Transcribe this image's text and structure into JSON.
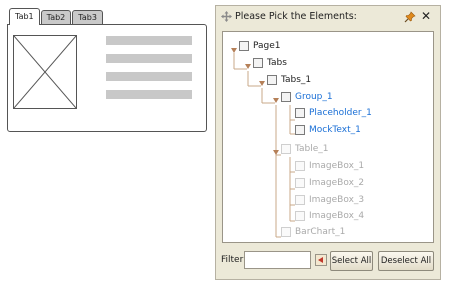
{
  "mockup": {
    "tabs": [
      "Tab1",
      "Tab2",
      "Tab3"
    ],
    "active_tab": "Tab1"
  },
  "dialog": {
    "title": "Please Pick the Elements:",
    "icons": {
      "move": "move-icon",
      "pin": "pin-icon",
      "close": "close-icon"
    },
    "tree": {
      "nodes": [
        {
          "label": "Page1",
          "state": "normal",
          "expandable": true
        },
        {
          "label": "Tabs",
          "state": "normal",
          "expandable": true
        },
        {
          "label": "Tabs_1",
          "state": "normal",
          "expandable": true
        },
        {
          "label": "Group_1",
          "state": "selected",
          "expandable": true
        },
        {
          "label": "Placeholder_1",
          "state": "selected",
          "expandable": false
        },
        {
          "label": "MockText_1",
          "state": "selected",
          "expandable": false
        },
        {
          "label": "Table_1",
          "state": "disabled",
          "expandable": true
        },
        {
          "label": "ImageBox_1",
          "state": "disabled",
          "expandable": false
        },
        {
          "label": "ImageBox_2",
          "state": "disabled",
          "expandable": false
        },
        {
          "label": "ImageBox_3",
          "state": "disabled",
          "expandable": false
        },
        {
          "label": "ImageBox_4",
          "state": "disabled",
          "expandable": false
        },
        {
          "label": "BarChart_1",
          "state": "disabled",
          "expandable": false
        }
      ]
    },
    "filter": {
      "label": "Filter:",
      "value": ""
    },
    "buttons": {
      "select_all": "Select All",
      "deselect_all": "Deselect All"
    },
    "colors": {
      "selected_text": "#1a6fd6",
      "disabled_text": "#aaaaaa",
      "dialog_bg": "#ece9d8",
      "tree_line": "#c9a889"
    }
  }
}
